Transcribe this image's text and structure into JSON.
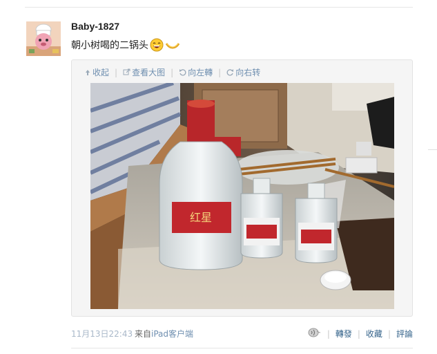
{
  "post": {
    "username": "Baby-1827",
    "text": "朝小树喝的二锅头"
  },
  "toolbar": {
    "collapse_label": "收起",
    "view_large_label": "查看大图",
    "rotate_left_label": "向左轉",
    "rotate_right_label": "向右转"
  },
  "footer": {
    "timestamp": "11月13日22:43",
    "source_prefix": "来自",
    "source": "iPad客户端",
    "repost_label": "轉發",
    "favorite_label": "收藏",
    "comment_label": "評論"
  },
  "icons": {
    "emoji": "laughing-emoji-icon",
    "thumbs": "thumbs-up-icon",
    "voice": "voice-icon"
  },
  "colors": {
    "link": "#36648b",
    "muted_link": "#6f8fb0",
    "timestamp": "#a9b8c9"
  }
}
